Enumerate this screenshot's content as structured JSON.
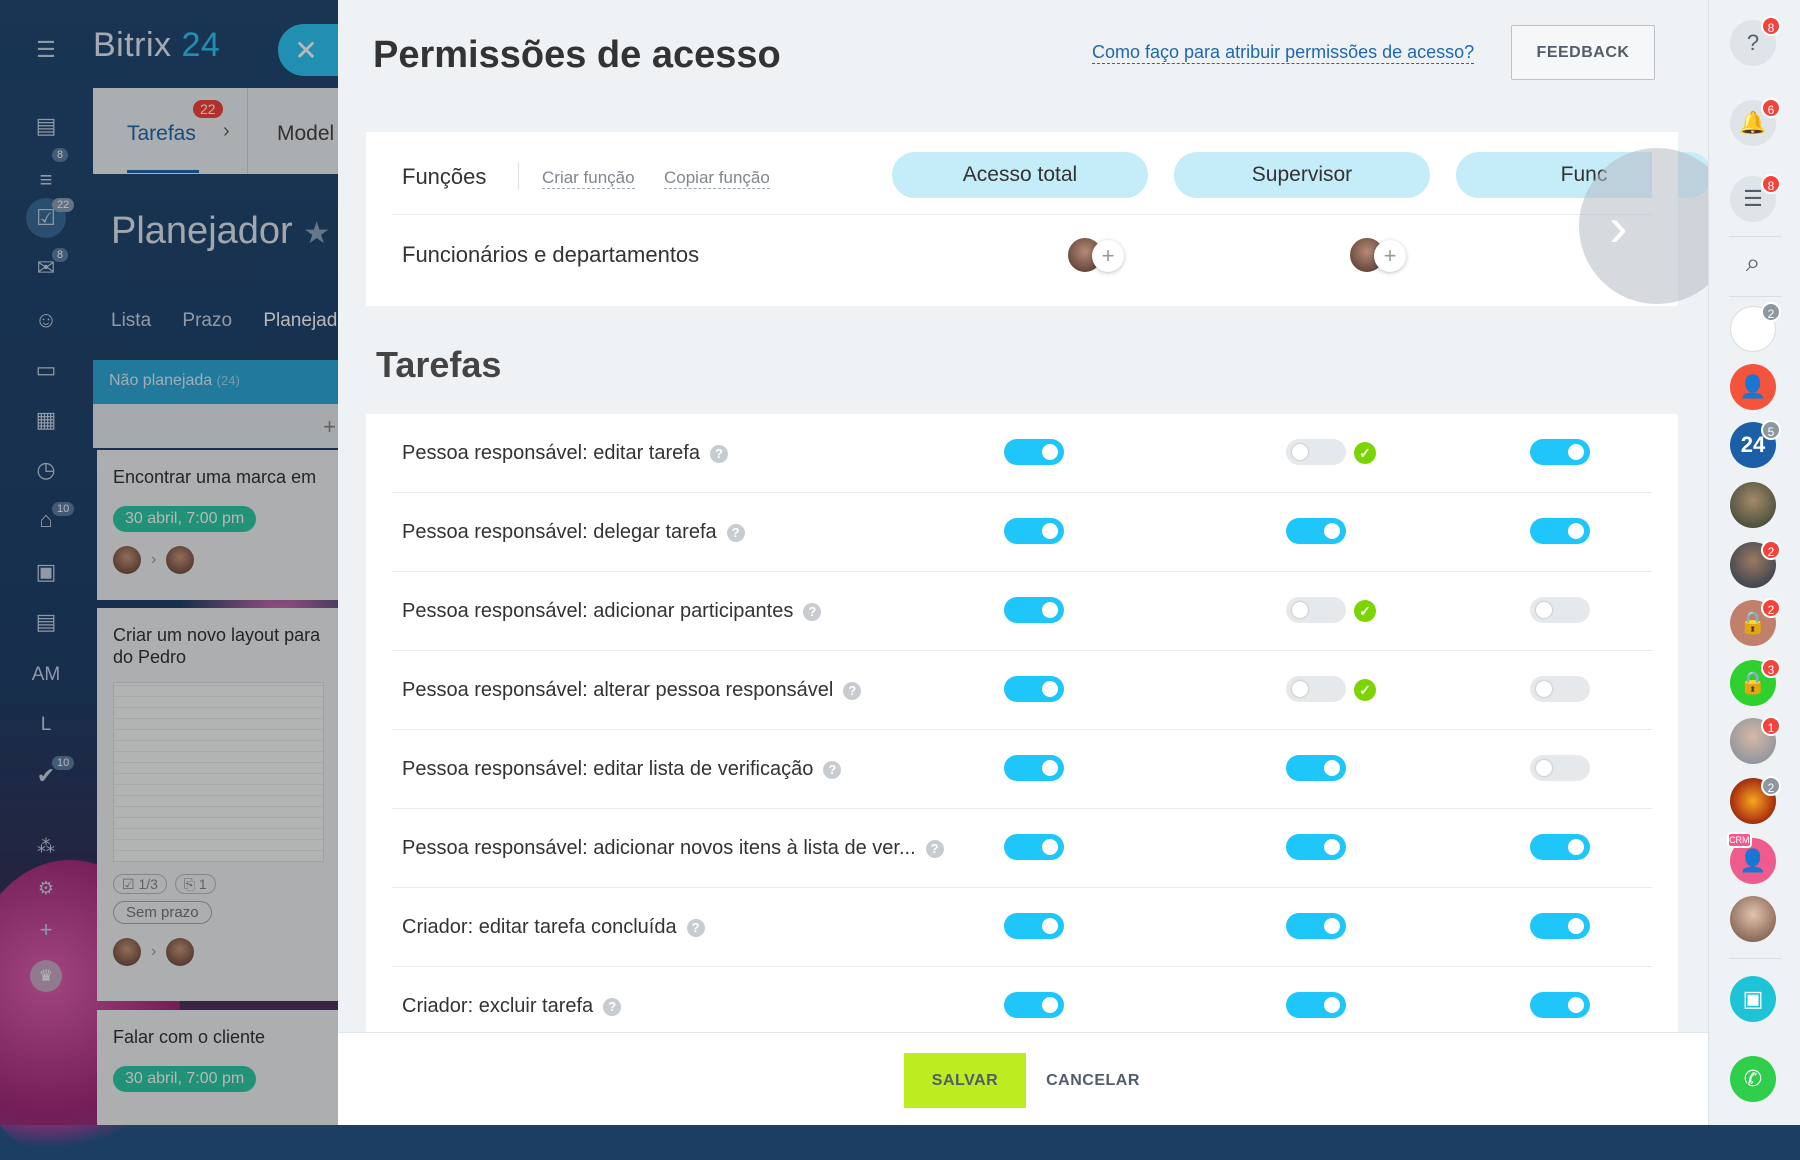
{
  "background": {
    "brand_name": "Bitrix",
    "brand_num": "24",
    "tabs": [
      {
        "label": "Tarefas",
        "badge": "22"
      },
      {
        "label": "Model"
      }
    ],
    "page_title": "Planejador",
    "views": [
      "Lista",
      "Prazo",
      "Planejad"
    ],
    "column": {
      "title": "Não planejada",
      "count": "(24)"
    },
    "cards": [
      {
        "title": "Encontrar uma marca em",
        "date": "30 abril, 7:00 pm"
      },
      {
        "title": "Criar um novo layout para\ndo Pedro",
        "checklist": "1/3",
        "attachments": "1",
        "deadline": "Sem prazo"
      },
      {
        "title": "Falar com o cliente",
        "date": "30 abril, 7:00 pm"
      }
    ],
    "left_rail": {
      "badges": {
        "filter": "8",
        "tasks": "22",
        "chat": "8",
        "robot": "10",
        "check": "10"
      },
      "texts": [
        "AM",
        "L"
      ]
    }
  },
  "panel": {
    "title": "Permissões de acesso",
    "help_link": "Como faço para atribuir permissões de acesso?",
    "feedback": "FEEDBACK",
    "roles": {
      "label": "Funções",
      "create": "Criar função",
      "copy": "Copiar função",
      "columns": [
        "Acesso total",
        "Supervisor",
        "Func"
      ]
    },
    "employees_label": "Funcionários e departamentos",
    "section_title": "Tarefas",
    "permissions": [
      {
        "label": "Pessoa responsável: editar tarefa",
        "values": [
          true,
          false,
          true
        ],
        "check": [
          false,
          true,
          false
        ]
      },
      {
        "label": "Pessoa responsável: delegar tarefa",
        "values": [
          true,
          true,
          true
        ],
        "check": [
          false,
          false,
          false
        ]
      },
      {
        "label": "Pessoa responsável: adicionar participantes",
        "values": [
          true,
          false,
          false
        ],
        "check": [
          false,
          true,
          false
        ]
      },
      {
        "label": "Pessoa responsável: alterar pessoa responsável",
        "values": [
          true,
          false,
          false
        ],
        "check": [
          false,
          true,
          false
        ]
      },
      {
        "label": "Pessoa responsável: editar lista de verificação",
        "values": [
          true,
          true,
          false
        ],
        "check": [
          false,
          false,
          false
        ]
      },
      {
        "label": "Pessoa responsável: adicionar novos itens à lista de ver...",
        "values": [
          true,
          true,
          true
        ],
        "check": [
          false,
          false,
          false
        ]
      },
      {
        "label": "Criador: editar tarefa concluída",
        "values": [
          true,
          true,
          true
        ],
        "check": [
          false,
          false,
          false
        ]
      },
      {
        "label": "Criador: excluir tarefa",
        "values": [
          true,
          true,
          true
        ],
        "check": [
          false,
          false,
          false
        ]
      }
    ],
    "save": "SALVAR",
    "cancel": "CANCELAR"
  },
  "right_rail": {
    "badges": {
      "help": "8",
      "notifications": "6",
      "chat": "8",
      "avatar1": "2",
      "company": "5",
      "avatar3": "2",
      "lock1": "2",
      "lock2": "3",
      "avatar4": "1",
      "avatar5": "2"
    },
    "company_logo": "24",
    "crm_tag": "CRM"
  },
  "colors": {
    "accent": "#2fc6f6",
    "toggle_on": "#1ec6fa",
    "check": "#7bd500",
    "save": "#bbed21",
    "badge": "#f4433c"
  }
}
